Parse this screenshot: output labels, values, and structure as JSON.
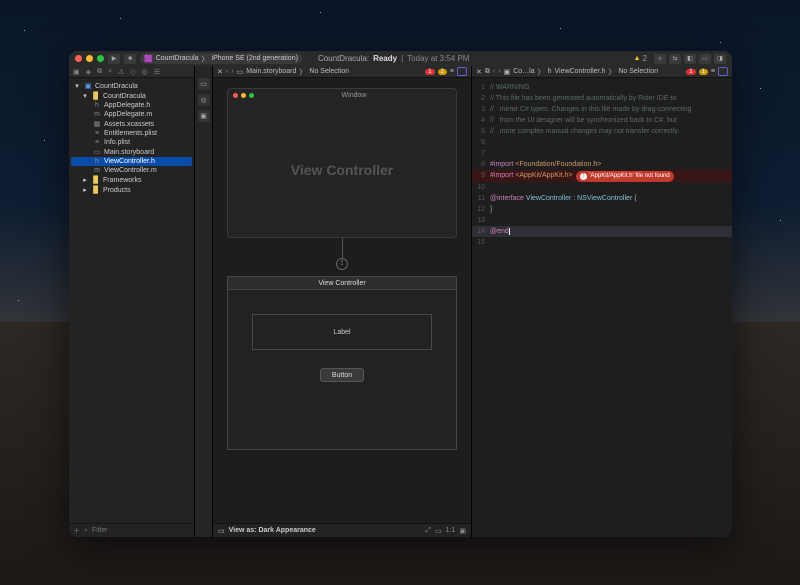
{
  "titlebar": {
    "project": "CountDracula",
    "device": "iPhone SE (2nd generation)",
    "status_prefix": "CountDracula:",
    "status": "Ready",
    "status_time": "Today at 3:54 PM",
    "warn_count": "2"
  },
  "sidebar": {
    "project": "CountDracula",
    "group": "CountDracula",
    "files": [
      "AppDelegate.h",
      "AppDelegate.m",
      "Assets.xcassets",
      "Entitlements.plist",
      "Info.plist",
      "Main.storyboard",
      "ViewController.h",
      "ViewController.m"
    ],
    "frameworks": "Frameworks",
    "products": "Products",
    "filter_placeholder": "Filter"
  },
  "ib": {
    "tab": "Main.storyboard",
    "crumb": "No Selection",
    "err": "1",
    "warn": "2",
    "window_title": "Window",
    "vc_placeholder": "View Controller",
    "scene_title": "View Controller",
    "label_text": "Label",
    "button_text": "Button",
    "view_as": "View as: Dark Appearance"
  },
  "code": {
    "tab": "Co…la",
    "crumb_file": "ViewController.h",
    "crumb_sel": "No Selection",
    "err": "1",
    "warn": "1",
    "lines": {
      "1": {
        "g": "1",
        "c": "// WARNING",
        "cls": "cm"
      },
      "2": {
        "g": "2",
        "c": "// This file has been generated automatically by Rider IDE to",
        "cls": "cm"
      },
      "3": {
        "g": "3",
        "c": "//   mirror C# types. Changes in this file made by drag-connecting",
        "cls": "cm"
      },
      "4": {
        "g": "4",
        "c": "//   from the UI designer will be synchronized back to C#, but",
        "cls": "cm"
      },
      "5": {
        "g": "5",
        "c": "//   more complex manual changes may not transfer correctly.",
        "cls": "cm"
      },
      "6": {
        "g": "6",
        "c": ""
      },
      "7": {
        "g": "7",
        "c": ""
      },
      "8": {
        "g": "8"
      },
      "9": {
        "g": "9"
      },
      "10": {
        "g": "10",
        "c": ""
      },
      "11": {
        "g": "11"
      },
      "12": {
        "g": "12",
        "c": "}"
      },
      "13": {
        "g": "13",
        "c": ""
      },
      "14": {
        "g": "14"
      },
      "14b": {
        "g": "15",
        "c": ""
      }
    },
    "import1_kw": "#import",
    "import1_lib": " <Foundation/Foundation.h>",
    "import2_kw": "#import",
    "import2_lib": " <AppKit/AppKit.h>",
    "err_msg": "'AppKit/AppKit.h' file not found",
    "iface_kw": "@interface",
    "iface_cls": " ViewController",
    "iface_colon": " : ",
    "iface_super": "NSViewController",
    "iface_brace": " {",
    "end_kw": "@end"
  }
}
